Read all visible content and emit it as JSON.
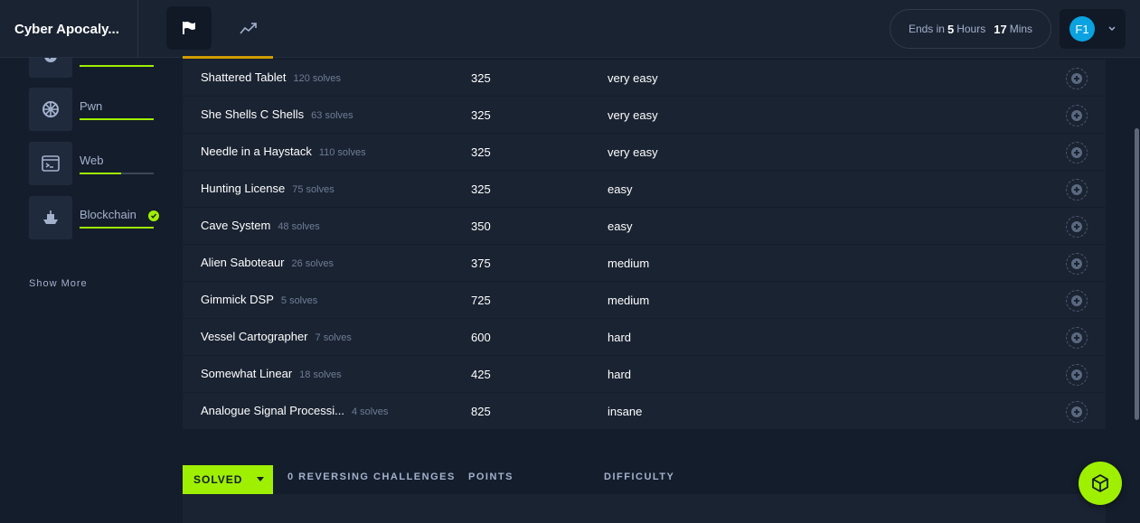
{
  "header": {
    "app_title": "Cyber Apocaly...",
    "timer": {
      "prefix": "Ends in",
      "hours_value": "5",
      "hours_label": "Hours",
      "mins_value": "17",
      "mins_label": "Mins"
    },
    "user_initials": "F1"
  },
  "sidebar": {
    "categories": [
      {
        "label": "",
        "progress": 1.0,
        "icon": "shield-icon"
      },
      {
        "label": "Pwn",
        "progress": 1.0,
        "icon": "bug-icon"
      },
      {
        "label": "Web",
        "progress": 0.55,
        "icon": "browser-icon"
      },
      {
        "label": "Blockchain",
        "progress": 1.0,
        "icon": "ship-icon",
        "completed": true
      }
    ],
    "show_more": "Show More"
  },
  "challenges": [
    {
      "name": "Shattered Tablet",
      "solves": "120 solves",
      "points": "325",
      "difficulty": "very easy"
    },
    {
      "name": "She Shells C Shells",
      "solves": "63 solves",
      "points": "325",
      "difficulty": "very easy"
    },
    {
      "name": "Needle in a Haystack",
      "solves": "110 solves",
      "points": "325",
      "difficulty": "very easy"
    },
    {
      "name": "Hunting License",
      "solves": "75 solves",
      "points": "325",
      "difficulty": "easy"
    },
    {
      "name": "Cave System",
      "solves": "48 solves",
      "points": "350",
      "difficulty": "easy"
    },
    {
      "name": "Alien Saboteaur",
      "solves": "26 solves",
      "points": "375",
      "difficulty": "medium"
    },
    {
      "name": "Gimmick DSP",
      "solves": "5 solves",
      "points": "725",
      "difficulty": "medium"
    },
    {
      "name": "Vessel Cartographer",
      "solves": "7 solves",
      "points": "600",
      "difficulty": "hard"
    },
    {
      "name": "Somewhat Linear",
      "solves": "18 solves",
      "points": "425",
      "difficulty": "hard"
    },
    {
      "name": "Analogue Signal Processi...",
      "solves": "4 solves",
      "points": "825",
      "difficulty": "insane"
    }
  ],
  "solved_section": {
    "dropdown_label": "SOLVED",
    "count_label": "0 REVERSING CHALLENGES",
    "points_header": "POINTS",
    "difficulty_header": "DIFFICULTY"
  },
  "colors": {
    "accent": "#9fef00",
    "background": "#141d2b",
    "panel": "#1a2332",
    "active_tab": "#cf9c00"
  }
}
